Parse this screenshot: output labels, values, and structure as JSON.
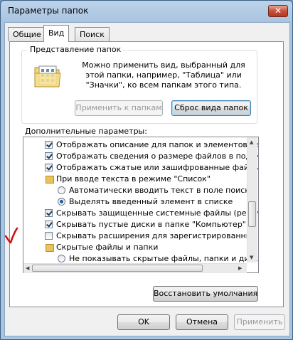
{
  "window": {
    "title": "Параметры папок",
    "close_glyph": "✕"
  },
  "tabs": [
    {
      "label": "Общие"
    },
    {
      "label": "Вид"
    },
    {
      "label": "Поиск"
    }
  ],
  "folder_view": {
    "legend": "Представление папок",
    "description": "Можно применить вид, выбранный для этой папки, например, \"Таблица\" или \"Значки\", ко всем папкам этого типа.",
    "apply_button": "Применить к папкам",
    "reset_button": "Сброс вида папок"
  },
  "advanced": {
    "label": "Дополнительные параметры:",
    "items": [
      {
        "kind": "checkbox",
        "checked": true,
        "label": "Отображать описание для папок и элементов рабоче"
      },
      {
        "kind": "checkbox",
        "checked": true,
        "label": "Отображать сведения о размере файлов в подсказк"
      },
      {
        "kind": "checkbox",
        "checked": true,
        "label": "Отображать сжатые или зашифрованные файлы NTI"
      },
      {
        "kind": "folder",
        "label": "При вводе текста в режиме \"Список\""
      },
      {
        "kind": "radio",
        "checked": false,
        "label": "Автоматически вводить текст в поле поиска"
      },
      {
        "kind": "radio",
        "checked": true,
        "label": "Выделять введенный элемент в списке"
      },
      {
        "kind": "checkbox",
        "checked": true,
        "label": "Скрывать защищенные системные файлы (рекомен"
      },
      {
        "kind": "checkbox",
        "checked": true,
        "label": "Скрывать пустые диски в папке \"Компьютер\""
      },
      {
        "kind": "checkbox",
        "checked": false,
        "label": "Скрывать расширения для зарегистрированных типо"
      },
      {
        "kind": "folder",
        "label": "Скрытые файлы и папки"
      },
      {
        "kind": "radio",
        "checked": false,
        "label": "Не показывать скрытые файлы, папки и диски"
      }
    ],
    "restore_button": "Восстановить умолчания"
  },
  "footer": {
    "ok": "OK",
    "cancel": "Отмена",
    "apply": "Применить"
  },
  "colors": {
    "annotation": "#cc1010",
    "accent": "#3c7fb1"
  }
}
